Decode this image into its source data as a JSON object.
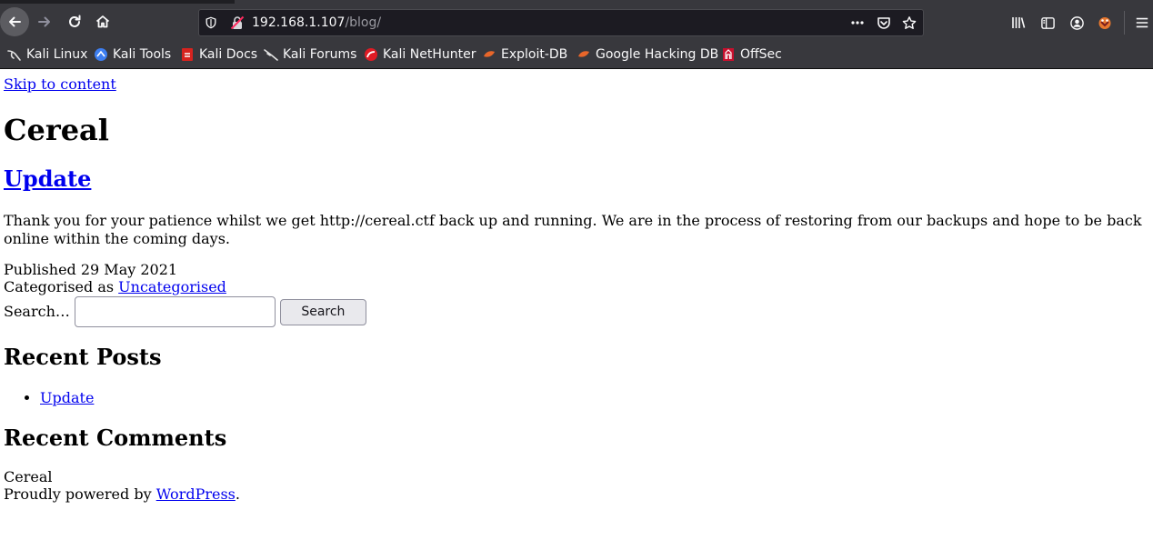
{
  "browser": {
    "url_host": "192.168.1.107",
    "url_path": "/blog/",
    "bookmarks": [
      {
        "label": "Kali Linux",
        "icon": "kali-dragon-icon"
      },
      {
        "label": "Kali Tools",
        "icon": "kali-tools-icon"
      },
      {
        "label": "Kali Docs",
        "icon": "kali-docs-icon"
      },
      {
        "label": "Kali Forums",
        "icon": "kali-forums-icon"
      },
      {
        "label": "Kali NetHunter",
        "icon": "nethunter-icon"
      },
      {
        "label": "Exploit-DB",
        "icon": "exploit-db-icon"
      },
      {
        "label": "Google Hacking DB",
        "icon": "ghdb-icon"
      },
      {
        "label": "OffSec",
        "icon": "offsec-icon"
      }
    ]
  },
  "page": {
    "skip_link": "Skip to content",
    "site_title": "Cereal",
    "post": {
      "title": "Update",
      "body": "Thank you for your patience whilst we get http://cereal.ctf back up and running. We are in the process of restoring from our backups and hope to be back online within the coming days.",
      "published": "Published 29 May 2021",
      "categorised_prefix": "Categorised as ",
      "category": "Uncategorised"
    },
    "search": {
      "label": "Search…",
      "value": "",
      "button": "Search"
    },
    "recent_posts": {
      "heading": "Recent Posts",
      "items": [
        "Update"
      ]
    },
    "recent_comments": {
      "heading": "Recent Comments"
    },
    "footer": {
      "site_name": "Cereal",
      "powered_prefix": "Proudly powered by ",
      "powered_link": "WordPress",
      "powered_suffix": "."
    }
  }
}
